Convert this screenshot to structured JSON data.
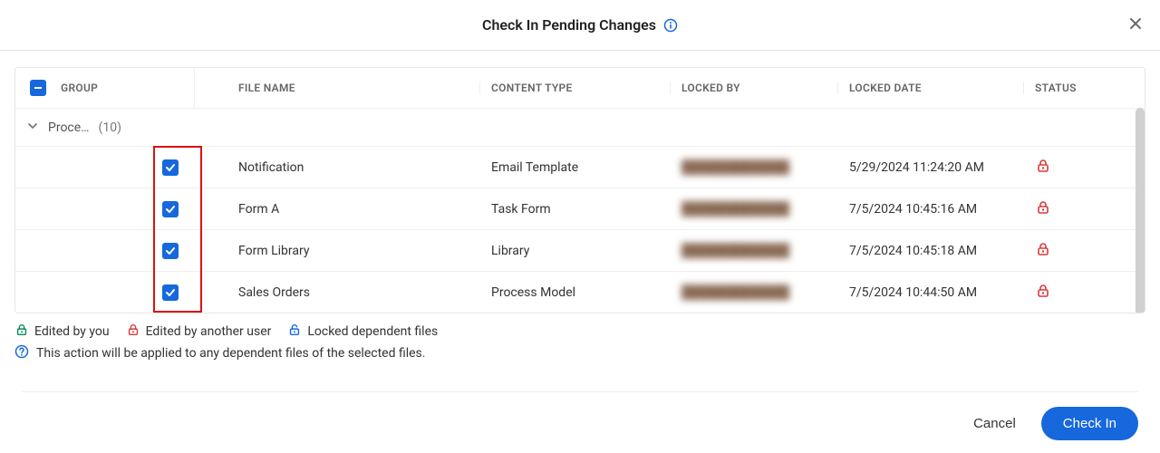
{
  "header": {
    "title": "Check In Pending Changes"
  },
  "columns": {
    "group": "GROUP",
    "file_name": "FILE NAME",
    "content_type": "CONTENT TYPE",
    "locked_by": "LOCKED BY",
    "locked_date": "LOCKED DATE",
    "status": "STATUS"
  },
  "group": {
    "label": "Proce…",
    "count": "(10)"
  },
  "rows": [
    {
      "file": "Notification",
      "type": "Email Template",
      "locked_by": "████████████",
      "date": "5/29/2024 11:24:20 AM"
    },
    {
      "file": "Form A",
      "type": "Task Form",
      "locked_by": "████████████",
      "date": "7/5/2024 10:45:16 AM"
    },
    {
      "file": "Form Library",
      "type": "Library",
      "locked_by": "████████████",
      "date": "7/5/2024 10:45:18 AM"
    },
    {
      "file": "Sales Orders",
      "type": "Process Model",
      "locked_by": "████████████",
      "date": "7/5/2024 10:44:50 AM"
    }
  ],
  "legend": {
    "you": "Edited by you",
    "other": "Edited by another user",
    "dep": "Locked dependent files"
  },
  "hint": "This action will be applied to any dependent files of the selected files.",
  "footer": {
    "cancel": "Cancel",
    "confirm": "Check In"
  },
  "colors": {
    "primary": "#1668dc",
    "danger": "#d93a3a",
    "success": "#0a8a55"
  }
}
